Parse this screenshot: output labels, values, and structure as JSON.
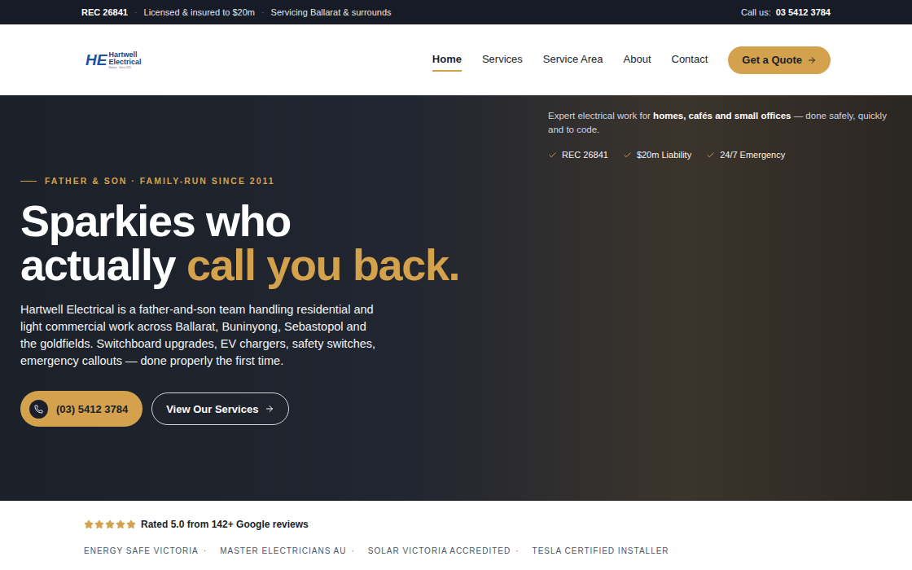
{
  "topbar": {
    "rec": "REC 26841",
    "items": [
      "Licensed & insured to $20m",
      "Servicing Ballarat & surrounds"
    ],
    "separator": "·",
    "call_label": "Call us:",
    "phone": "03 5412 3784"
  },
  "header": {
    "logo": {
      "initials": "HE",
      "line1": "Hartwell",
      "line2": "Electrical",
      "tagline": "Ballarat · Since 2011"
    },
    "nav": [
      {
        "label": "Home",
        "selected": true
      },
      {
        "label": "Services",
        "selected": false
      },
      {
        "label": "Service Area",
        "selected": false
      },
      {
        "label": "About",
        "selected": false
      },
      {
        "label": "Contact",
        "selected": false
      }
    ],
    "cta": "Get a Quote"
  },
  "hero": {
    "intro": {
      "before": "Expert electrical work for ",
      "bold": "homes, cafés and small offices",
      "after": " — done safely, quickly and to code."
    },
    "badges": [
      "REC 26841",
      "$20m Liability",
      "24/7 Emergency"
    ],
    "eyebrow": "FATHER & SON · FAMILY-RUN SINCE 2011",
    "headline": {
      "line1": "Sparkies who",
      "line2_plain": "actually ",
      "line2_accent": "call you back."
    },
    "paragraph": "Hartwell Electrical is a father-and-son team handling residential and light commercial work across Ballarat, Buninyong, Sebastopol and the goldfields. Switchboard upgrades, EV chargers, safety switches, emergency callouts — done properly the first time.",
    "phone_button": "(03) 5412 3784",
    "services_button": "View Our Services"
  },
  "rating": {
    "stars": 5,
    "text": "Rated 5.0 from 142+ Google reviews"
  },
  "accreditations": [
    "ENERGY SAFE VICTORIA",
    "MASTER ELECTRICIANS AU",
    "SOLAR VICTORIA ACCREDITED",
    "TESLA CERTIFIED INSTALLER"
  ],
  "accreditation_separator": "·"
}
